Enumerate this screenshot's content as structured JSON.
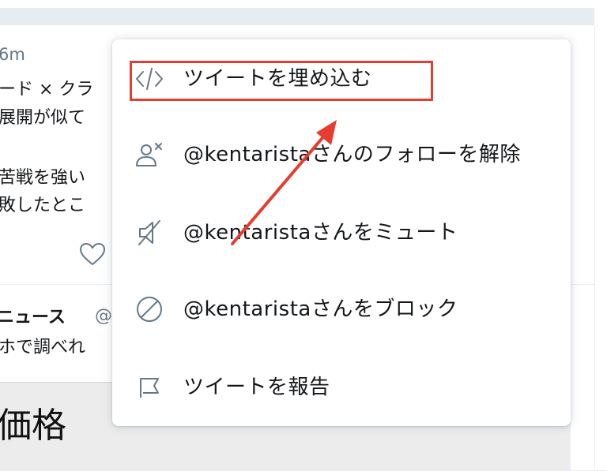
{
  "timeline": {
    "time": "6m",
    "tweet_line1": "ード × クラ",
    "tweet_line2": "展開が似て",
    "tweet_line3": "苦戦を強い",
    "tweet_line4": "敗したとこ",
    "user2_name": "ニュース",
    "user2_handle": "@",
    "tweet2_line1": "ホで調べれ",
    "media_text": "価格"
  },
  "menu": {
    "items": [
      {
        "label": "ツイートを埋め込む",
        "icon": "code-embed-icon"
      },
      {
        "label": "@kentaristaさんのフォローを解除",
        "icon": "unfollow-user-icon"
      },
      {
        "label": "@kentaristaさんをミュート",
        "icon": "mute-speaker-icon"
      },
      {
        "label": "@kentaristaさんをブロック",
        "icon": "block-icon"
      },
      {
        "label": "ツイートを報告",
        "icon": "report-flag-icon"
      }
    ]
  },
  "annotation": {
    "highlight_color": "#e53d2f",
    "arrow_color": "#e53d2f"
  }
}
